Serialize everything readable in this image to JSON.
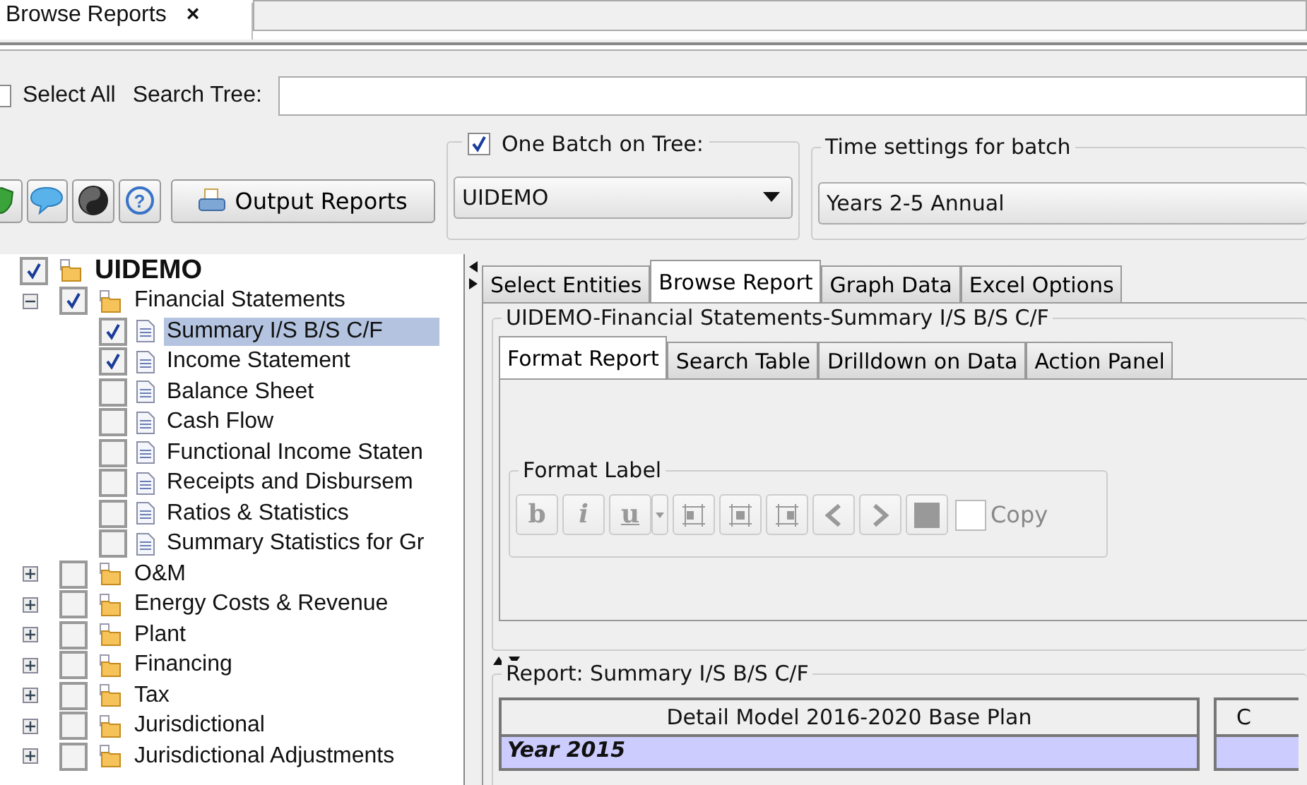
{
  "doc_tab": {
    "label": "Browse Reports",
    "close": "×"
  },
  "select_all": {
    "label": "Select All",
    "checked": false
  },
  "search_tree": {
    "label": "Search Tree:"
  },
  "tool_buttons": [
    {
      "kind": "shield"
    },
    {
      "kind": "chat"
    },
    {
      "kind": "yinyang"
    },
    {
      "kind": "help",
      "glyph": "?"
    }
  ],
  "output_button": {
    "label": "Output Reports"
  },
  "batch": {
    "label": "One Batch on Tree:",
    "checked": true,
    "value": "UIDEMO"
  },
  "time_settings": {
    "title": "Time settings for batch",
    "value": "Years 2-5 Annual"
  },
  "tree": [
    {
      "label": "UIDEMO",
      "kind": "root",
      "checked": true,
      "selected": false,
      "children": [
        {
          "label": "Financial Statements",
          "kind": "folder",
          "checked": true,
          "expanded": true,
          "selected": false,
          "children": [
            {
              "label": "Summary I/S B/S C/F",
              "kind": "report",
              "checked": true,
              "selected": true
            },
            {
              "label": "Income Statement",
              "kind": "report",
              "checked": true,
              "selected": false
            },
            {
              "label": "Balance Sheet",
              "kind": "report",
              "checked": false,
              "selected": false
            },
            {
              "label": "Cash Flow",
              "kind": "report",
              "checked": false,
              "selected": false
            },
            {
              "label": "Functional Income Staten",
              "kind": "report",
              "checked": false,
              "selected": false
            },
            {
              "label": "Receipts and Disbursem",
              "kind": "report",
              "checked": false,
              "selected": false
            },
            {
              "label": "Ratios & Statistics",
              "kind": "report",
              "checked": false,
              "selected": false
            },
            {
              "label": "Summary Statistics for Gr",
              "kind": "report",
              "checked": false,
              "selected": false
            }
          ]
        },
        {
          "label": "O&M",
          "kind": "folder",
          "checked": false,
          "expanded": false,
          "selected": false
        },
        {
          "label": "Energy Costs & Revenue",
          "kind": "folder",
          "checked": false,
          "expanded": false,
          "selected": false
        },
        {
          "label": "Plant",
          "kind": "folder",
          "checked": false,
          "expanded": false,
          "selected": false
        },
        {
          "label": "Financing",
          "kind": "folder",
          "checked": false,
          "expanded": false,
          "selected": false
        },
        {
          "label": "Tax",
          "kind": "folder",
          "checked": false,
          "expanded": false,
          "selected": false
        },
        {
          "label": "Jurisdictional",
          "kind": "folder",
          "checked": false,
          "expanded": false,
          "selected": false
        },
        {
          "label": "Jurisdictional Adjustments",
          "kind": "folder",
          "checked": false,
          "expanded": false,
          "selected": false
        }
      ]
    }
  ],
  "main_tabs": [
    {
      "label": "Select Entities",
      "selected": false
    },
    {
      "label": "Browse Report",
      "selected": true
    },
    {
      "label": "Graph Data",
      "selected": false
    },
    {
      "label": "Excel Options",
      "selected": false
    }
  ],
  "report_group": {
    "title": "UIDEMO-Financial Statements-Summary I/S B/S C/F"
  },
  "sub_tabs": [
    {
      "label": "Format Report",
      "selected": true
    },
    {
      "label": "Search Table",
      "selected": false
    },
    {
      "label": "Drilldown on Data",
      "selected": false
    },
    {
      "label": "Action Panel",
      "selected": false
    }
  ],
  "format_label": {
    "title": "Format Label",
    "buttons": [
      {
        "kind": "bold",
        "label": "b",
        "disabled": true
      },
      {
        "kind": "italic",
        "label": "i",
        "disabled": true
      },
      {
        "kind": "underline",
        "label": "u",
        "disabled": true
      },
      {
        "kind": "caret",
        "disabled": true
      },
      {
        "kind": "frame-left",
        "disabled": true
      },
      {
        "kind": "frame-center",
        "disabled": true
      },
      {
        "kind": "frame-right",
        "disabled": true
      },
      {
        "kind": "prev",
        "disabled": true
      },
      {
        "kind": "next",
        "disabled": true
      },
      {
        "kind": "square",
        "disabled": true
      }
    ],
    "copy": {
      "label": "Copy",
      "checked": false,
      "disabled": true
    }
  },
  "report": {
    "title": "Report: Summary I/S B/S C/F",
    "columns": [
      "Detail Model 2016-2020 Base Plan",
      "C"
    ],
    "rows": [
      {
        "cells": [
          "Year 2015",
          ""
        ],
        "kind": "section"
      }
    ]
  }
}
